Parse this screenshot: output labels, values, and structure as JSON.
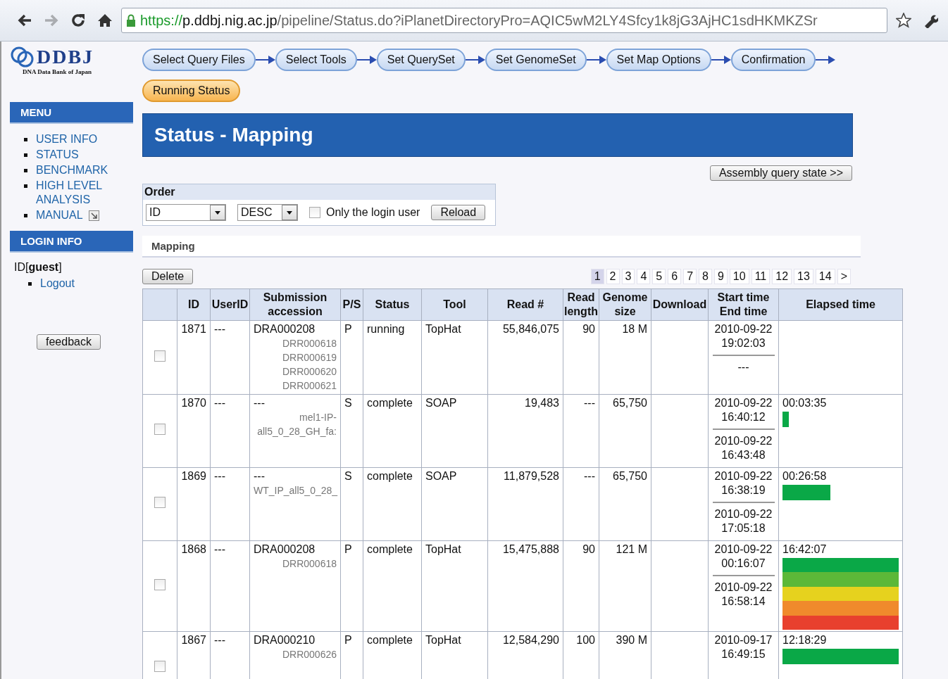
{
  "browser": {
    "back_disabled": false,
    "forward_disabled": true,
    "url": {
      "scheme": "https://",
      "host": "p.ddbj.nig.ac.jp",
      "path": "/pipeline/Status.do?iPlanetDirectoryPro=AQIC5wM2LY4Sfcy1k8jG3AjHC1sdHKMKZSr"
    }
  },
  "logo": {
    "title": "DDBJ",
    "subtitle": "DNA Data Bank of Japan"
  },
  "steps": [
    {
      "label": "Select Query Files",
      "selected": false
    },
    {
      "label": "Select Tools",
      "selected": false
    },
    {
      "label": "Set QuerySet",
      "selected": false
    },
    {
      "label": "Set GenomeSet",
      "selected": false
    },
    {
      "label": "Set Map Options",
      "selected": false
    },
    {
      "label": "Confirmation",
      "selected": false
    },
    {
      "label": "Running Status",
      "selected": true
    }
  ],
  "sidebar": {
    "menu_title": "MENU",
    "menu": [
      {
        "label": "USER INFO",
        "external": false
      },
      {
        "label": "STATUS",
        "external": false
      },
      {
        "label": "BENCHMARK",
        "external": false
      },
      {
        "label": "HIGH LEVEL ANALYSIS",
        "external": false
      },
      {
        "label": "MANUAL",
        "external": true
      }
    ],
    "login_title": "LOGIN INFO",
    "login_prefix": "ID[",
    "login_user": "guest",
    "login_suffix": "]",
    "login_links": [
      "Logout"
    ],
    "feedback": "feedback"
  },
  "page_title": "Status - Mapping",
  "assembly_button": "Assembly query state  >>",
  "order": {
    "title": "Order",
    "field": "ID",
    "direction": "DESC",
    "only_login_user": {
      "label": "Only the login user",
      "checked": false
    },
    "reload": "Reload"
  },
  "section_title": "Mapping",
  "delete_button": "Delete",
  "pages": [
    {
      "label": "1",
      "selected": true
    },
    {
      "label": "2",
      "selected": false
    },
    {
      "label": "3",
      "selected": false
    },
    {
      "label": "4",
      "selected": false
    },
    {
      "label": "5",
      "selected": false
    },
    {
      "label": "6",
      "selected": false
    },
    {
      "label": "7",
      "selected": false
    },
    {
      "label": "8",
      "selected": false
    },
    {
      "label": "9",
      "selected": false
    },
    {
      "label": "10",
      "selected": false
    },
    {
      "label": "11",
      "selected": false
    },
    {
      "label": "12",
      "selected": false
    },
    {
      "label": "13",
      "selected": false
    },
    {
      "label": "14",
      "selected": false
    },
    {
      "label": ">",
      "selected": false
    }
  ],
  "table": {
    "columns": [
      "",
      "ID",
      "UserID",
      "Submission accession",
      "P/S",
      "Status",
      "Tool",
      "Read #",
      "Read length",
      "Genome size",
      "Download",
      "Start time End time",
      "Elapsed time"
    ],
    "rows": [
      {
        "checked": false,
        "id": "1871",
        "user": "---",
        "accession": "DRA000208",
        "runs": [
          "DRR000618",
          "DRR000619",
          "DRR000620",
          "DRR000621"
        ],
        "ps": "P",
        "status": "running",
        "tool": "TopHat",
        "reads": "55,846,075",
        "read_length": "90",
        "genome_size": "18 M",
        "start": [
          "2010-09-22",
          "19:02:03"
        ],
        "end": [
          "---"
        ]
      },
      {
        "checked": false,
        "id": "1870",
        "user": "---",
        "accession": "---",
        "runs": [
          "mel1-IP-",
          "all5_0_28_GH_fa:"
        ],
        "ps": "S",
        "status": "complete",
        "tool": "SOAP",
        "reads": "19,483",
        "read_length": "---",
        "genome_size": "65,750",
        "start": [
          "2010-09-22",
          "16:40:12"
        ],
        "end": [
          "2010-09-22",
          "16:43:48"
        ],
        "elapsed": "00:03:35",
        "bar": {
          "bands": [
            {
              "color": "#0aa847"
            }
          ]
        }
      },
      {
        "checked": false,
        "id": "1869",
        "user": "---",
        "accession": "---",
        "runs": [
          "WT_IP_all5_0_28_"
        ],
        "ps": "S",
        "status": "complete",
        "tool": "SOAP",
        "reads": "11,879,528",
        "read_length": "---",
        "genome_size": "65,750",
        "start": [
          "2010-09-22",
          "16:38:19"
        ],
        "end": [
          "2010-09-22",
          "17:05:18"
        ],
        "elapsed": "00:26:58",
        "bar": {
          "bands": [
            {
              "color": "#0aa847"
            }
          ]
        }
      },
      {
        "checked": false,
        "id": "1868",
        "user": "---",
        "accession": "DRA000208",
        "runs": [
          "DRR000618"
        ],
        "ps": "P",
        "status": "complete",
        "tool": "TopHat",
        "reads": "15,475,888",
        "read_length": "90",
        "genome_size": "121 M",
        "start": [
          "2010-09-22",
          "00:16:07"
        ],
        "end": [
          "2010-09-22",
          "16:58:14"
        ],
        "elapsed": "16:42:07",
        "bar": {
          "bands": [
            {
              "color": "#0aa847"
            },
            {
              "color": "#5cb838"
            },
            {
              "color": "#e6d21e"
            },
            {
              "color": "#f08a2c"
            },
            {
              "color": "#e8402e"
            }
          ]
        }
      },
      {
        "checked": false,
        "id": "1867",
        "user": "---",
        "accession": "DRA000210",
        "runs": [
          "DRR000626"
        ],
        "ps": "P",
        "status": "complete",
        "tool": "TopHat",
        "reads": "12,584,290",
        "read_length": "100",
        "genome_size": "390 M",
        "start": [
          "2010-09-17",
          "16:49:15"
        ],
        "elapsed": "12:18:29",
        "bar": {
          "bands": [
            {
              "color": "#0aa847"
            }
          ]
        }
      }
    ]
  }
}
